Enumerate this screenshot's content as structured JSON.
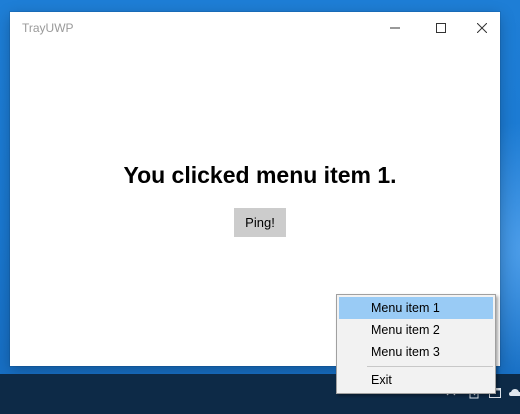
{
  "window": {
    "title": "TrayUWP"
  },
  "main": {
    "message": "You clicked menu item 1.",
    "ping_label": "Ping!"
  },
  "context_menu": {
    "items": [
      {
        "label": "Menu item 1",
        "highlighted": true
      },
      {
        "label": "Menu item 2",
        "highlighted": false
      },
      {
        "label": "Menu item 3",
        "highlighted": false
      },
      {
        "label": "Exit",
        "highlighted": false
      }
    ]
  },
  "colors": {
    "desktop": "#1a78d0",
    "taskbar": "#0d2a47",
    "menu_highlight": "#99cbf5",
    "button_bg": "#cccccc"
  },
  "icons": {
    "caption": [
      "minimize-icon",
      "maximize-icon",
      "close-icon"
    ],
    "tray": [
      "chevron-up-icon",
      "pen-icon",
      "window-icon",
      "cloud-icon"
    ]
  }
}
